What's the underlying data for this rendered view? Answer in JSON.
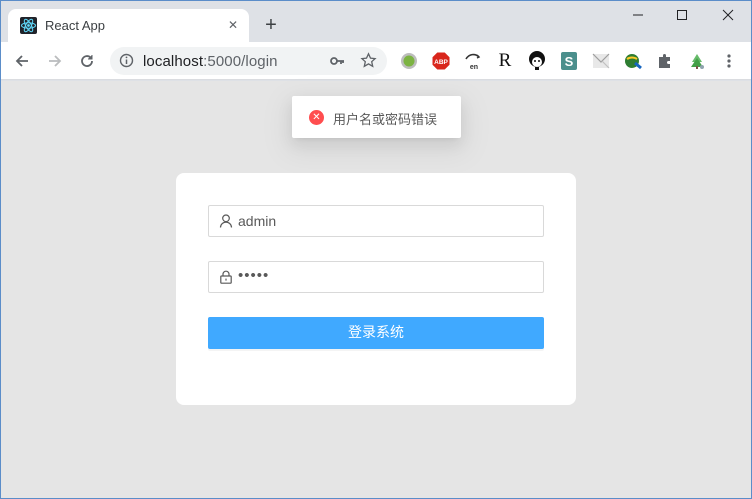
{
  "browser": {
    "tab": {
      "title": "React App",
      "favicon": "react-icon",
      "close_glyph": "✕"
    },
    "new_tab_glyph": "+",
    "url_host": "localhost",
    "url_path": ":5000/login",
    "extensions": [
      "green-circle-extension",
      "adblock-plus-extension",
      "translate-extension",
      "r-extension",
      "avatar-extension",
      "s-extension",
      "mail-extension",
      "vpn-extension",
      "puzzle-extension",
      "tree-extension"
    ],
    "ext_labels": {
      "abp": "ABP",
      "r": "R",
      "s": "S",
      "en": "en"
    }
  },
  "message": {
    "type": "error",
    "icon_glyph": "✕",
    "text": "用户名或密码错误",
    "color": "#ff4d4f"
  },
  "login": {
    "username_value": "admin",
    "password_value": "•••••",
    "submit_label": "登录系统",
    "accent_color": "#40a9ff"
  }
}
